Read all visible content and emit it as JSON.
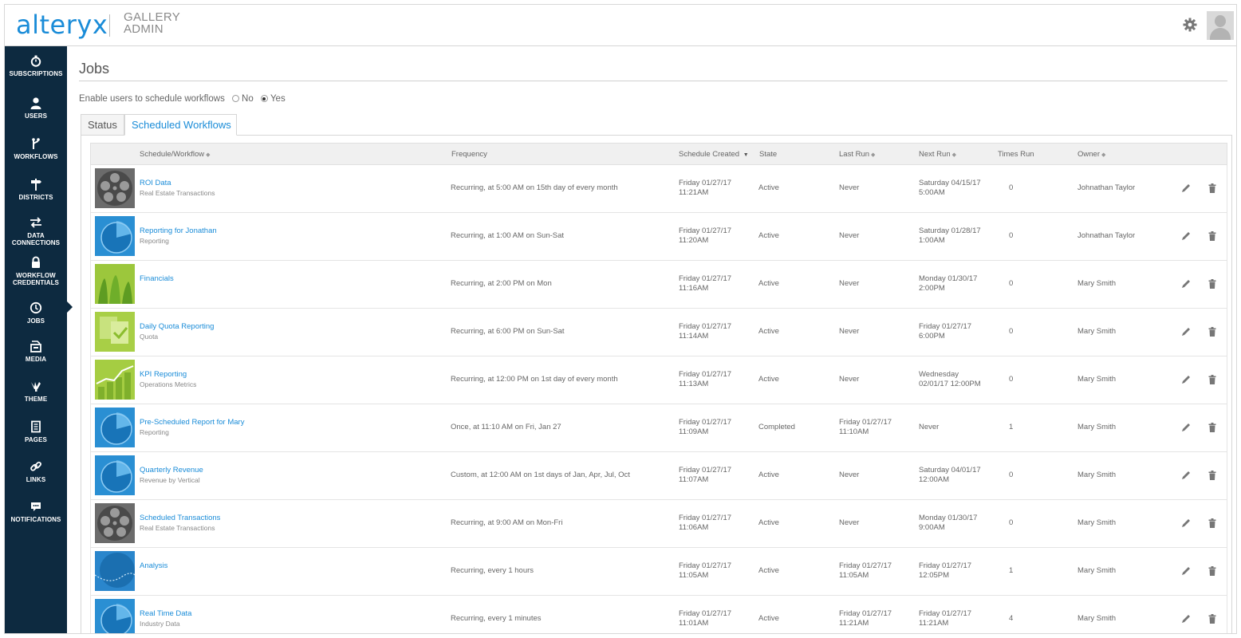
{
  "header": {
    "logo": "alteryx",
    "product_line1": "GALLERY",
    "product_line2": "ADMIN"
  },
  "colors": {
    "brand_blue": "#1a8cd8",
    "sidebar_bg": "#0d2a40",
    "header_bg": "#f0f0f0"
  },
  "sidebar": {
    "items": [
      {
        "label": "SUBSCRIPTIONS",
        "icon": "stopwatch-icon"
      },
      {
        "label": "USERS",
        "icon": "user-icon"
      },
      {
        "label": "WORKFLOWS",
        "icon": "workflow-fork-icon"
      },
      {
        "label": "DISTRICTS",
        "icon": "signpost-icon"
      },
      {
        "label_line1": "DATA",
        "label_line2": "CONNECTIONS",
        "icon": "arrows-exchange-icon"
      },
      {
        "label_line1": "WORKFLOW",
        "label_line2": "CREDENTIALS",
        "icon": "lock-icon"
      },
      {
        "label": "JOBS",
        "icon": "clock-icon"
      },
      {
        "label": "MEDIA",
        "icon": "media-box-icon"
      },
      {
        "label": "THEME",
        "icon": "theme-brush-icon"
      },
      {
        "label": "PAGES",
        "icon": "page-icon"
      },
      {
        "label": "LINKS",
        "icon": "link-icon"
      },
      {
        "label": "NOTIFICATIONS",
        "icon": "notification-bubble-icon"
      }
    ]
  },
  "main": {
    "title": "Jobs",
    "enable_label": "Enable users to schedule workflows",
    "option_no": "No",
    "option_yes": "Yes",
    "selected_option": "Yes",
    "tabs": [
      {
        "label": "Status",
        "active": false
      },
      {
        "label": "Scheduled Workflows",
        "active": true
      }
    ]
  },
  "table": {
    "columns": {
      "schedule": "Schedule/Workflow",
      "frequency": "Frequency",
      "created": "Schedule Created",
      "state": "State",
      "last_run": "Last Run",
      "next_run": "Next Run",
      "times_run": "Times Run",
      "owner": "Owner"
    },
    "rows": [
      {
        "thumb": "film-reel",
        "name": "ROI Data",
        "sub": "Real Estate Transactions",
        "frequency": "Recurring, at 5:00 AM on 15th day of every month",
        "created1": "Friday 01/27/17",
        "created2": "11:21AM",
        "state": "Active",
        "last1": "Never",
        "last2": "",
        "next1": "Saturday 04/15/17",
        "next2": "5:00AM",
        "times": "0",
        "owner": "Johnathan Taylor"
      },
      {
        "thumb": "blue-pie",
        "name": "Reporting for Jonathan",
        "sub": "Reporting",
        "frequency": "Recurring, at 1:00 AM on Sun-Sat",
        "created1": "Friday 01/27/17",
        "created2": "11:20AM",
        "state": "Active",
        "last1": "Never",
        "last2": "",
        "next1": "Saturday 01/28/17",
        "next2": "1:00AM",
        "times": "0",
        "owner": "Johnathan Taylor"
      },
      {
        "thumb": "green-financial",
        "name": "Financials",
        "sub": "",
        "frequency": "Recurring, at 2:00 PM on Mon",
        "created1": "Friday 01/27/17",
        "created2": "11:16AM",
        "state": "Active",
        "last1": "Never",
        "last2": "",
        "next1": "Monday 01/30/17",
        "next2": "2:00PM",
        "times": "0",
        "owner": "Mary Smith"
      },
      {
        "thumb": "green-doc",
        "name": "Daily Quota Reporting",
        "sub": "Quota",
        "frequency": "Recurring, at 6:00 PM on Sun-Sat",
        "created1": "Friday 01/27/17",
        "created2": "11:14AM",
        "state": "Active",
        "last1": "Never",
        "last2": "",
        "next1": "Friday 01/27/17",
        "next2": "6:00PM",
        "times": "0",
        "owner": "Mary Smith"
      },
      {
        "thumb": "green-chart",
        "name": "KPI Reporting",
        "sub": "Operations Metrics",
        "frequency": "Recurring, at 12:00 PM on 1st day of every month",
        "created1": "Friday 01/27/17",
        "created2": "11:13AM",
        "state": "Active",
        "last1": "Never",
        "last2": "",
        "next1": "Wednesday",
        "next2": "02/01/17 12:00PM",
        "times": "0",
        "owner": "Mary Smith"
      },
      {
        "thumb": "blue-pie",
        "name": "Pre-Scheduled Report for Mary",
        "sub": "Reporting",
        "frequency": "Once, at 11:10 AM on Fri, Jan 27",
        "created1": "Friday 01/27/17",
        "created2": "11:09AM",
        "state": "Completed",
        "last1": "Friday 01/27/17",
        "last2": "11:10AM",
        "next1": "Never",
        "next2": "",
        "times": "1",
        "owner": "Mary Smith"
      },
      {
        "thumb": "blue-pie",
        "name": "Quarterly Revenue",
        "sub": "Revenue by Vertical",
        "frequency": "Custom, at 12:00 AM on 1st days of Jan, Apr, Jul, Oct",
        "created1": "Friday 01/27/17",
        "created2": "11:07AM",
        "state": "Active",
        "last1": "Never",
        "last2": "",
        "next1": "Saturday 04/01/17",
        "next2": "12:00AM",
        "times": "0",
        "owner": "Mary Smith"
      },
      {
        "thumb": "film-reel",
        "name": "Scheduled Transactions",
        "sub": "Real Estate Transactions",
        "frequency": "Recurring, at 9:00 AM on Mon-Fri",
        "created1": "Friday 01/27/17",
        "created2": "11:06AM",
        "state": "Active",
        "last1": "Never",
        "last2": "",
        "next1": "Monday 01/30/17",
        "next2": "9:00AM",
        "times": "0",
        "owner": "Mary Smith"
      },
      {
        "thumb": "blue-wave",
        "name": "Analysis",
        "sub": "",
        "frequency": "Recurring, every 1 hours",
        "created1": "Friday 01/27/17",
        "created2": "11:05AM",
        "state": "Active",
        "last1": "Friday 01/27/17",
        "last2": "11:05AM",
        "next1": "Friday 01/27/17",
        "next2": "12:05PM",
        "times": "1",
        "owner": "Mary Smith"
      },
      {
        "thumb": "blue-pie",
        "name": "Real Time Data",
        "sub": "Industry Data",
        "frequency": "Recurring, every 1 minutes",
        "created1": "Friday 01/27/17",
        "created2": "11:01AM",
        "state": "Active",
        "last1": "Friday 01/27/17",
        "last2": "11:21AM",
        "next1": "Friday 01/27/17",
        "next2": "11:21AM",
        "times": "4",
        "owner": "Mary Smith"
      }
    ]
  }
}
